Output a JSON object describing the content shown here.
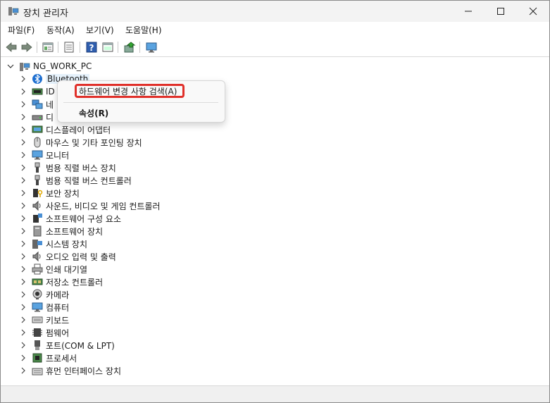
{
  "window": {
    "title": "장치 관리자"
  },
  "menu": [
    "파일(F)",
    "동작(A)",
    "보기(V)",
    "도움말(H)"
  ],
  "toolbar": [
    "back-icon",
    "forward-icon",
    "properties-icon",
    "list-icon",
    "help-icon",
    "view-icon",
    "update-driver-icon",
    "monitor-scan-icon"
  ],
  "tree": {
    "root": "NG_WORK_PC",
    "items": [
      {
        "label": "Bluetooth",
        "icon": "bluetooth-icon"
      },
      {
        "label": "ID",
        "icon": "ide-icon"
      },
      {
        "label": "네",
        "icon": "network-icon"
      },
      {
        "label": "디",
        "icon": "disk-icon"
      },
      {
        "label": "디스플레이 어댑터",
        "icon": "display-adapter-icon"
      },
      {
        "label": "마우스 및 기타 포인팅 장치",
        "icon": "mouse-icon"
      },
      {
        "label": "모니터",
        "icon": "monitor-icon"
      },
      {
        "label": "범용 직렬 버스 장치",
        "icon": "usb-icon"
      },
      {
        "label": "범용 직렬 버스 컨트롤러",
        "icon": "usb-controller-icon"
      },
      {
        "label": "보안 장치",
        "icon": "security-device-icon"
      },
      {
        "label": "사운드, 비디오 및 게임 컨트롤러",
        "icon": "sound-icon"
      },
      {
        "label": "소프트웨어 구성 요소",
        "icon": "software-component-icon"
      },
      {
        "label": "소프트웨어 장치",
        "icon": "software-device-icon"
      },
      {
        "label": "시스템 장치",
        "icon": "system-device-icon"
      },
      {
        "label": "오디오 입력 및 출력",
        "icon": "audio-io-icon"
      },
      {
        "label": "인쇄 대기열",
        "icon": "print-queue-icon"
      },
      {
        "label": "저장소 컨트롤러",
        "icon": "storage-controller-icon"
      },
      {
        "label": "카메라",
        "icon": "camera-icon"
      },
      {
        "label": "컴퓨터",
        "icon": "computer-icon"
      },
      {
        "label": "키보드",
        "icon": "keyboard-icon"
      },
      {
        "label": "펌웨어",
        "icon": "firmware-icon"
      },
      {
        "label": "포트(COM & LPT)",
        "icon": "port-icon"
      },
      {
        "label": "프로세서",
        "icon": "processor-icon"
      },
      {
        "label": "휴먼 인터페이스 장치",
        "icon": "hid-icon"
      }
    ]
  },
  "context_menu": {
    "scan_label": "하드웨어 변경 사항 검색(A)",
    "properties_label": "속성(R)"
  },
  "colors": {
    "highlight": "#e0302a",
    "titlebar": "#f3f3f3"
  }
}
